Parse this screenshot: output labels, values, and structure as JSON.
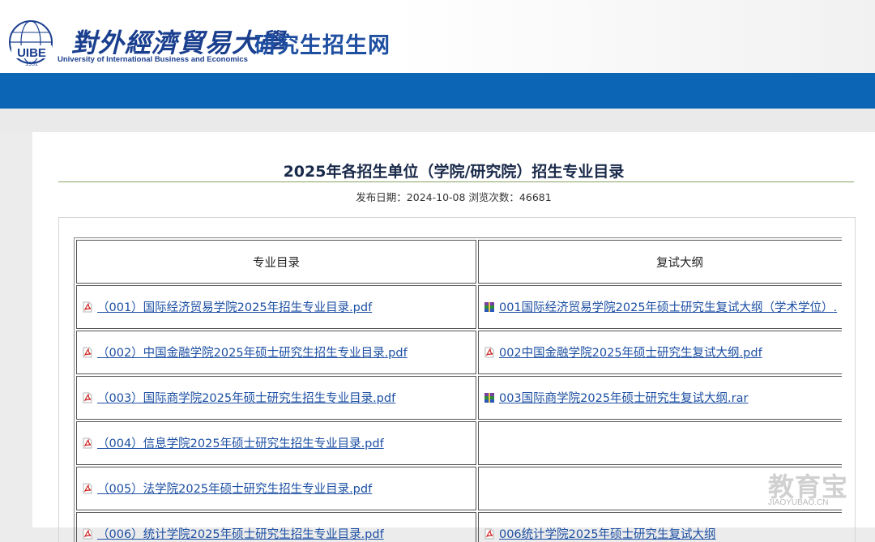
{
  "header": {
    "university_cn": "對外經濟貿易大學",
    "university_en": "University of International Business and Economics",
    "emblem_text": "UIBE",
    "emblem_year": "1951",
    "site_name": "研究生招生网"
  },
  "article": {
    "title": "2025年各招生单位（学院/研究院）招生专业目录",
    "meta": "发布日期：2024-10-08 浏览次数：46681"
  },
  "table": {
    "headers": [
      "专业目录",
      "复试大纲"
    ],
    "rows": [
      {
        "col1": {
          "text": "（001）国际经济贸易学院2025年招生专业目录.pdf",
          "icon": "pdf-icon"
        },
        "col2": {
          "text": "001国际经济贸易学院2025年硕士研究生复试大纲（学术学位）.",
          "icon": "rar-icon"
        }
      },
      {
        "col1": {
          "text": "（002）中国金融学院2025年硕士研究生招生专业目录.pdf",
          "icon": "pdf-icon"
        },
        "col2": {
          "text": "002中国金融学院2025年硕士研究生复试大纲.pdf",
          "icon": "pdf-icon"
        }
      },
      {
        "col1": {
          "text": "（003）国际商学院2025年硕士研究生招生专业目录.pdf",
          "icon": "pdf-icon"
        },
        "col2": {
          "text": "003国际商学院2025年硕士研究生复试大纲.rar",
          "icon": "rar-icon"
        }
      },
      {
        "col1": {
          "text": "（004）信息学院2025年硕士研究生招生专业目录.pdf",
          "icon": "pdf-icon"
        },
        "col2": {
          "text": "",
          "icon": ""
        }
      },
      {
        "col1": {
          "text": "（005）法学院2025年硕士研究生招生专业目录.pdf",
          "icon": "pdf-icon"
        },
        "col2": {
          "text": "",
          "icon": ""
        }
      },
      {
        "col1": {
          "text": "（006）统计学院2025年硕士研究生招生专业目录.pdf",
          "icon": "pdf-icon"
        },
        "col2": {
          "text": "006统计学院2025年硕士研究生复试大纲",
          "icon": "pdf-icon"
        }
      }
    ]
  },
  "watermark": {
    "cn": "教育宝",
    "en": "JIAOYUBAO.CN"
  },
  "colors": {
    "nav_blue": "#0d66b5",
    "link_blue": "#1c4fa3",
    "title_rule": "#8aa464",
    "brand_text": "#1b3f8f"
  }
}
